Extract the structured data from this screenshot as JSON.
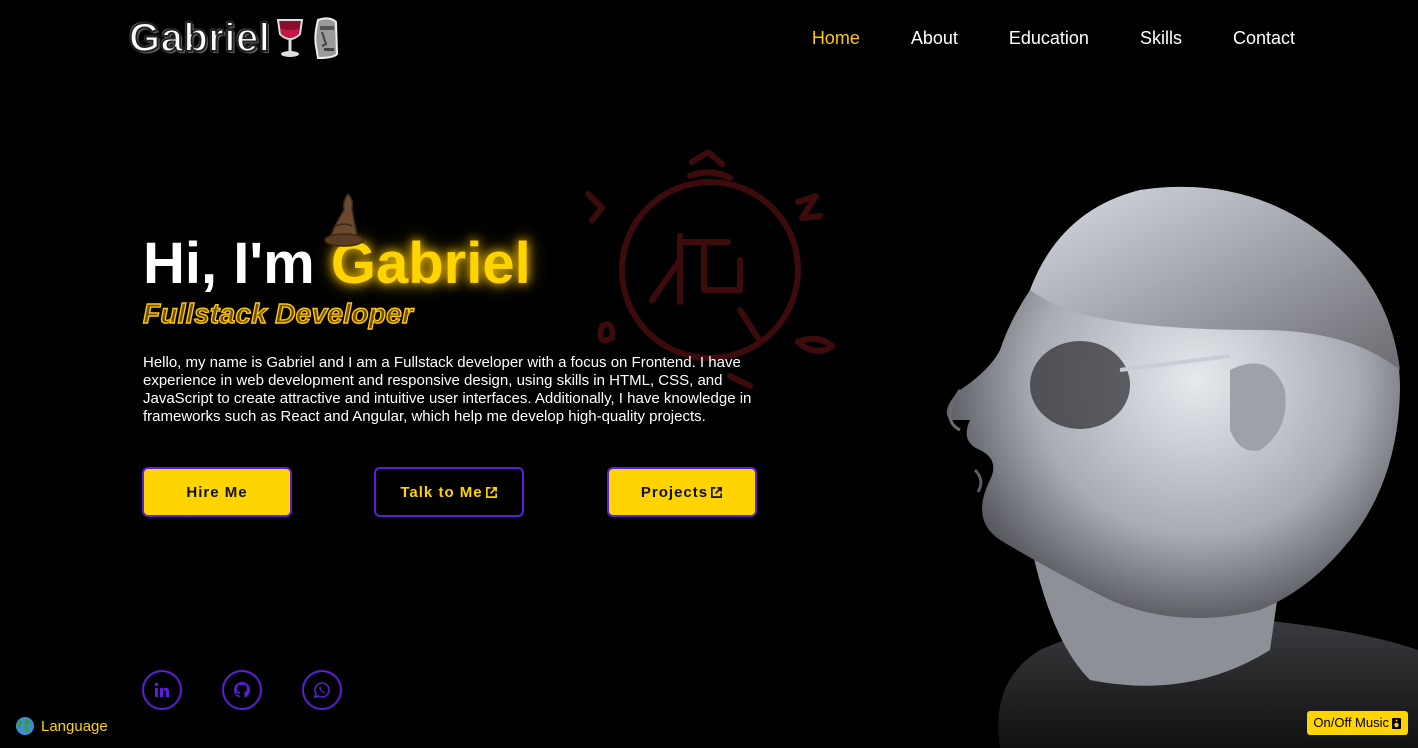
{
  "header": {
    "logo_text": "Gabriel",
    "logo_icons": [
      "wine-glass-icon",
      "moai-icon"
    ],
    "nav": [
      {
        "label": "Home",
        "active": true
      },
      {
        "label": "About",
        "active": false
      },
      {
        "label": "Education",
        "active": false
      },
      {
        "label": "Skills",
        "active": false
      },
      {
        "label": "Contact",
        "active": false
      }
    ]
  },
  "hero": {
    "greeting": "Hi, I'm ",
    "name": "Gabriel",
    "role": "Fullstack Developer",
    "intro": "Hello, my name is Gabriel and I am a Fullstack developer with a focus on Frontend. I have experience in web development and responsive design, using skills in HTML, CSS, and JavaScript to create attractive and intuitive user interfaces. Additionally, I have knowledge in frameworks such as React and Angular, which help me develop high-quality projects."
  },
  "buttons": {
    "hire": "Hire Me",
    "talk": "Talk to Me",
    "projects": "Projects"
  },
  "social": [
    "linkedin-icon",
    "github-icon",
    "whatsapp-icon"
  ],
  "language": {
    "label": "Language",
    "icon": "globe-icon"
  },
  "music": {
    "label": "On/Off Music"
  },
  "colors": {
    "accent": "#ffd400",
    "border": "#5b1fd6",
    "background": "#000000",
    "emblem": "#3a0a0a"
  }
}
